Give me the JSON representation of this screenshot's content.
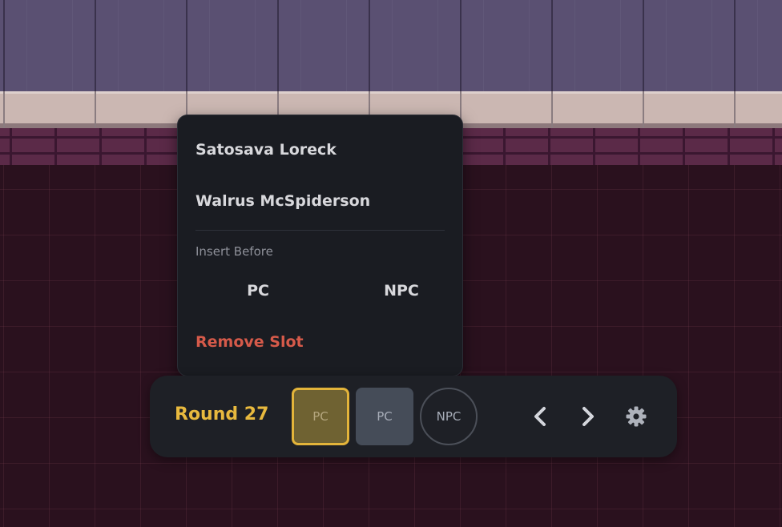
{
  "context_menu": {
    "items": [
      {
        "label": "Satosava Loreck"
      },
      {
        "label": "Walrus McSpiderson"
      }
    ],
    "section_label": "Insert Before",
    "insert_options": [
      {
        "label": "PC"
      },
      {
        "label": "NPC"
      }
    ],
    "remove_label": "Remove Slot"
  },
  "tracker": {
    "round_label": "Round 27",
    "slots": [
      {
        "label": "PC",
        "kind": "pc",
        "active": true
      },
      {
        "label": "PC",
        "kind": "pc",
        "active": false
      },
      {
        "label": "NPC",
        "kind": "npc",
        "active": false
      }
    ],
    "controls": {
      "prev_icon": "chevron-left-icon",
      "next_icon": "chevron-right-icon",
      "settings_icon": "gear-icon"
    }
  },
  "colors": {
    "accent": "#e3b43a",
    "round_text": "#e8b93e",
    "danger": "#d65a4a",
    "menu_bg": "#1a1c22",
    "bar_bg": "#1e2026"
  }
}
